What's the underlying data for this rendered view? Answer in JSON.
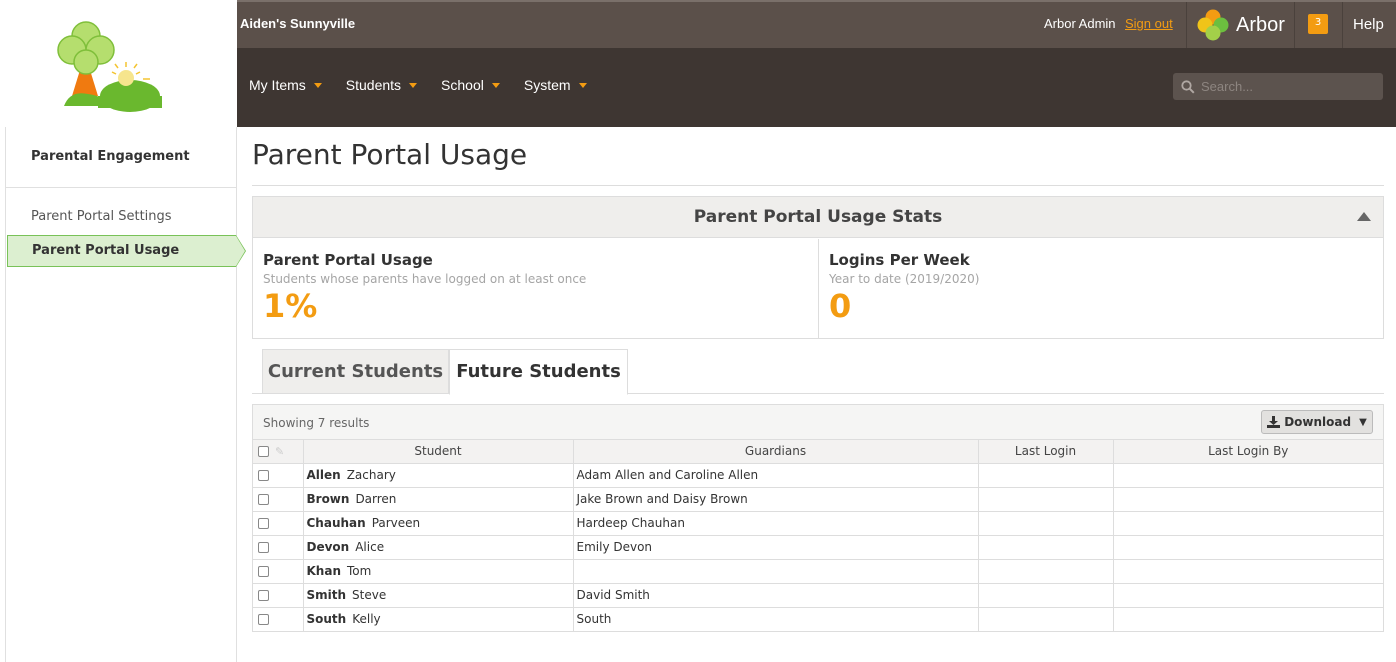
{
  "header": {
    "school_name": "Aiden's Sunnyville",
    "user_name": "Arbor Admin",
    "sign_out": "Sign out",
    "brand": "Arbor",
    "notification_count": "3",
    "help": "Help",
    "search_placeholder": "Search...",
    "nav": [
      "My Items",
      "Students",
      "School",
      "System"
    ]
  },
  "sidebar": {
    "section_title": "Parental Engagement",
    "items": [
      {
        "label": "Parent Portal Settings",
        "active": false
      },
      {
        "label": "Parent Portal Usage",
        "active": true
      }
    ]
  },
  "page": {
    "title": "Parent Portal Usage"
  },
  "stats": {
    "panel_title": "Parent Portal Usage Stats",
    "usage": {
      "title": "Parent Portal Usage",
      "subtitle": "Students whose parents have logged on at least once",
      "value": "1%"
    },
    "logins": {
      "title": "Logins Per Week",
      "subtitle": "Year to date (2019/2020)",
      "value": "0"
    }
  },
  "tabs": [
    {
      "label": "Current Students",
      "active": false
    },
    {
      "label": "Future Students",
      "active": true
    }
  ],
  "grid": {
    "showing": "Showing 7 results",
    "download": "Download",
    "columns": [
      "Student",
      "Guardians",
      "Last Login",
      "Last Login By"
    ],
    "rows": [
      {
        "last": "Allen",
        "first": "Zachary",
        "guardians": "Adam Allen and Caroline Allen",
        "last_login": "",
        "last_login_by": ""
      },
      {
        "last": "Brown",
        "first": "Darren",
        "guardians": "Jake Brown and Daisy Brown",
        "last_login": "",
        "last_login_by": ""
      },
      {
        "last": "Chauhan",
        "first": "Parveen",
        "guardians": "Hardeep Chauhan",
        "last_login": "",
        "last_login_by": ""
      },
      {
        "last": "Devon",
        "first": "Alice",
        "guardians": "Emily Devon",
        "last_login": "",
        "last_login_by": ""
      },
      {
        "last": "Khan",
        "first": "Tom",
        "guardians": "",
        "last_login": "",
        "last_login_by": ""
      },
      {
        "last": "Smith",
        "first": "Steve",
        "guardians": "David Smith",
        "last_login": "",
        "last_login_by": ""
      },
      {
        "last": "South",
        "first": "Kelly",
        "guardians": "South",
        "last_login": "",
        "last_login_by": ""
      }
    ]
  },
  "colors": {
    "accent": "#f39c12",
    "header_dark": "#3e3632",
    "header_strip": "#5b504a",
    "active_green": "#79c258"
  }
}
